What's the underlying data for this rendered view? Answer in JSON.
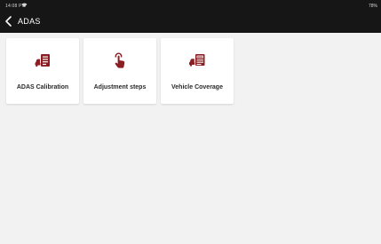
{
  "status_bar": {
    "time": "14:08 PM",
    "battery": "78%"
  },
  "header": {
    "title": "ADAS"
  },
  "tiles": [
    {
      "label": "ADAS Calibration",
      "icon": "calibration-car-doc-icon"
    },
    {
      "label": "Adjustment steps",
      "icon": "tap-hand-icon"
    },
    {
      "label": "Vehicle Coverage",
      "icon": "vehicle-test-icon"
    }
  ],
  "colors": {
    "accent": "#8b1e23",
    "topbar": "#161616",
    "background": "#f2f2f2"
  }
}
